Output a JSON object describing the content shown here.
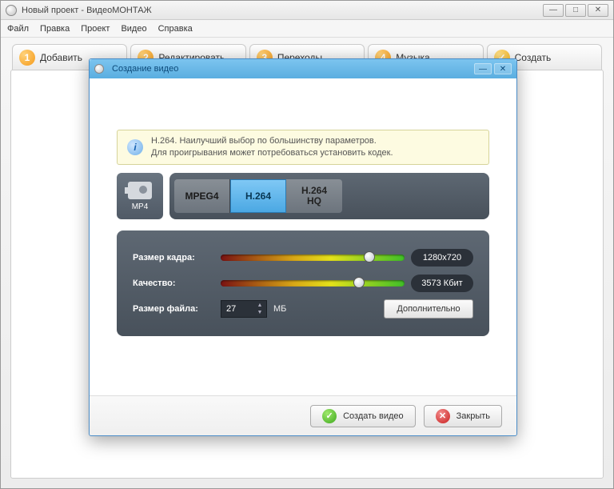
{
  "window": {
    "title": "Новый проект - ВидеоМОНТАЖ"
  },
  "menu": {
    "file": "Файл",
    "edit": "Правка",
    "project": "Проект",
    "video": "Видео",
    "help": "Справка"
  },
  "tabs": {
    "add": "Добавить",
    "edit": "Редактировать",
    "transitions": "Переходы",
    "music": "Музыка",
    "create": "Создать",
    "n1": "1",
    "n2": "2",
    "n3": "3",
    "n4": "4"
  },
  "dialog": {
    "title": "Создание видео",
    "info_line1": "H.264. Наилучший выбор по большинству параметров.",
    "info_line2": "Для проигрывания может потребоваться установить кодек.",
    "codec_icon_label": "MP4",
    "codec_mpeg4": "MPEG4",
    "codec_h264": "H.264",
    "codec_h264hq": "H.264\nHQ",
    "frame_label": "Размер кадра:",
    "frame_value": "1280x720",
    "quality_label": "Качество:",
    "quality_value": "3573 Кбит",
    "filesize_label": "Размер файла:",
    "filesize_value": "27",
    "filesize_unit": "МБ",
    "advanced": "Дополнительно",
    "create_btn": "Создать видео",
    "close_btn": "Закрыть",
    "check": "✓",
    "cross": "✕",
    "info": "i"
  },
  "slider": {
    "frame_pos": "78%",
    "quality_pos": "72%"
  }
}
